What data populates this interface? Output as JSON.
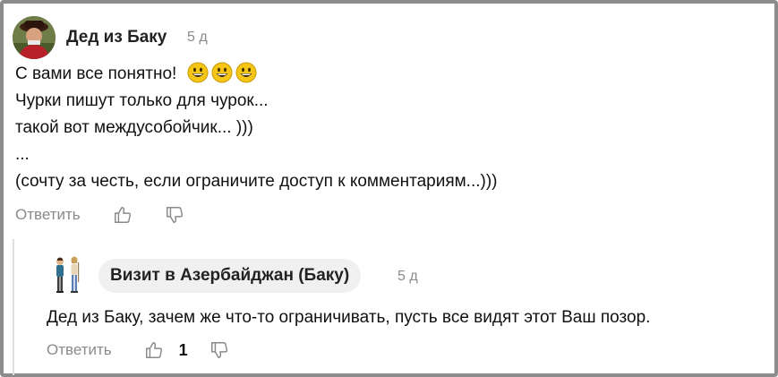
{
  "comment": {
    "author": "Дед из Баку",
    "time": "5 д",
    "lines": [
      "С вами все понятно!",
      "Чурки пишут только для чурок...",
      "такой вот междусобойчик... )))",
      "...",
      "(сочту за честь, если ограничите доступ к комментариям...)))"
    ],
    "emoji_icons": [
      "grinning-face-icon",
      "grinning-face-icon",
      "grinning-face-icon"
    ],
    "reply_label": "Ответить"
  },
  "reply": {
    "author": "Визит в Азербайджан (Баку)",
    "time": "5 д",
    "text": "Дед из Баку, зачем же что-то ограничивать, пусть все видят этот Ваш позор.",
    "reply_label": "Ответить",
    "like_count": "1"
  },
  "colors": {
    "frame": "#8c8c8c",
    "muted_text": "#8a8a8a",
    "pill_bg": "#f0f0f0",
    "emoji": "#f5c518"
  }
}
